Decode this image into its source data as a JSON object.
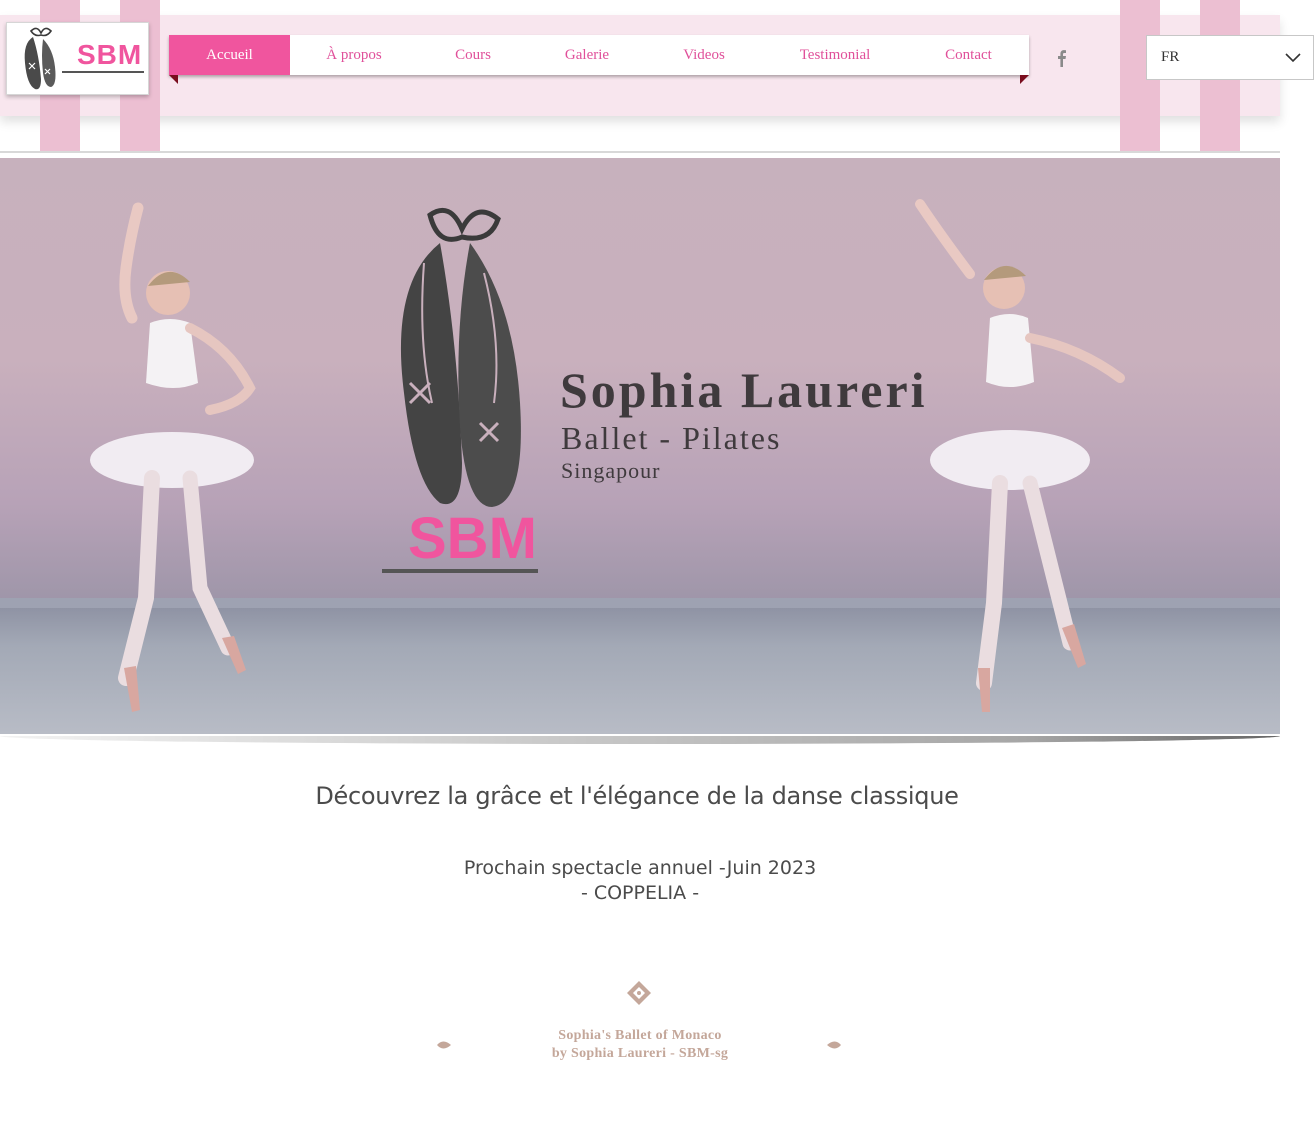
{
  "header": {
    "logo_text": "SBM",
    "nav": [
      {
        "label": "Accueil",
        "active": true
      },
      {
        "label": "À propos",
        "active": false
      },
      {
        "label": "Cours",
        "active": false
      },
      {
        "label": "Galerie",
        "active": false
      },
      {
        "label": "Videos",
        "active": false
      },
      {
        "label": "Testimonial",
        "active": false
      },
      {
        "label": "Contact",
        "active": false
      }
    ],
    "social_icon": "facebook-icon",
    "language": {
      "selected": "FR",
      "icon": "chevron-down-icon"
    }
  },
  "hero": {
    "name": "Sophia Laureri",
    "subtitle": "Ballet - Pilates",
    "city": "Singapour",
    "logo_text": "SBM"
  },
  "content": {
    "tagline": "Découvrez la grâce et l'élégance de la danse classique",
    "show_line_1": "Prochain spectacle annuel -Juin 2023",
    "show_line_2": "- COPPELIA -"
  },
  "footer": {
    "line_1": "Sophia's Ballet of Monaco",
    "line_2": "by Sophia Laureri - SBM-sg"
  },
  "colors": {
    "accent_pink": "#f0559e",
    "nav_text": "#e0509a",
    "header_bg": "#f8e6ee",
    "stripe": "#ecbfd2",
    "footer_text": "#c4a79a"
  }
}
